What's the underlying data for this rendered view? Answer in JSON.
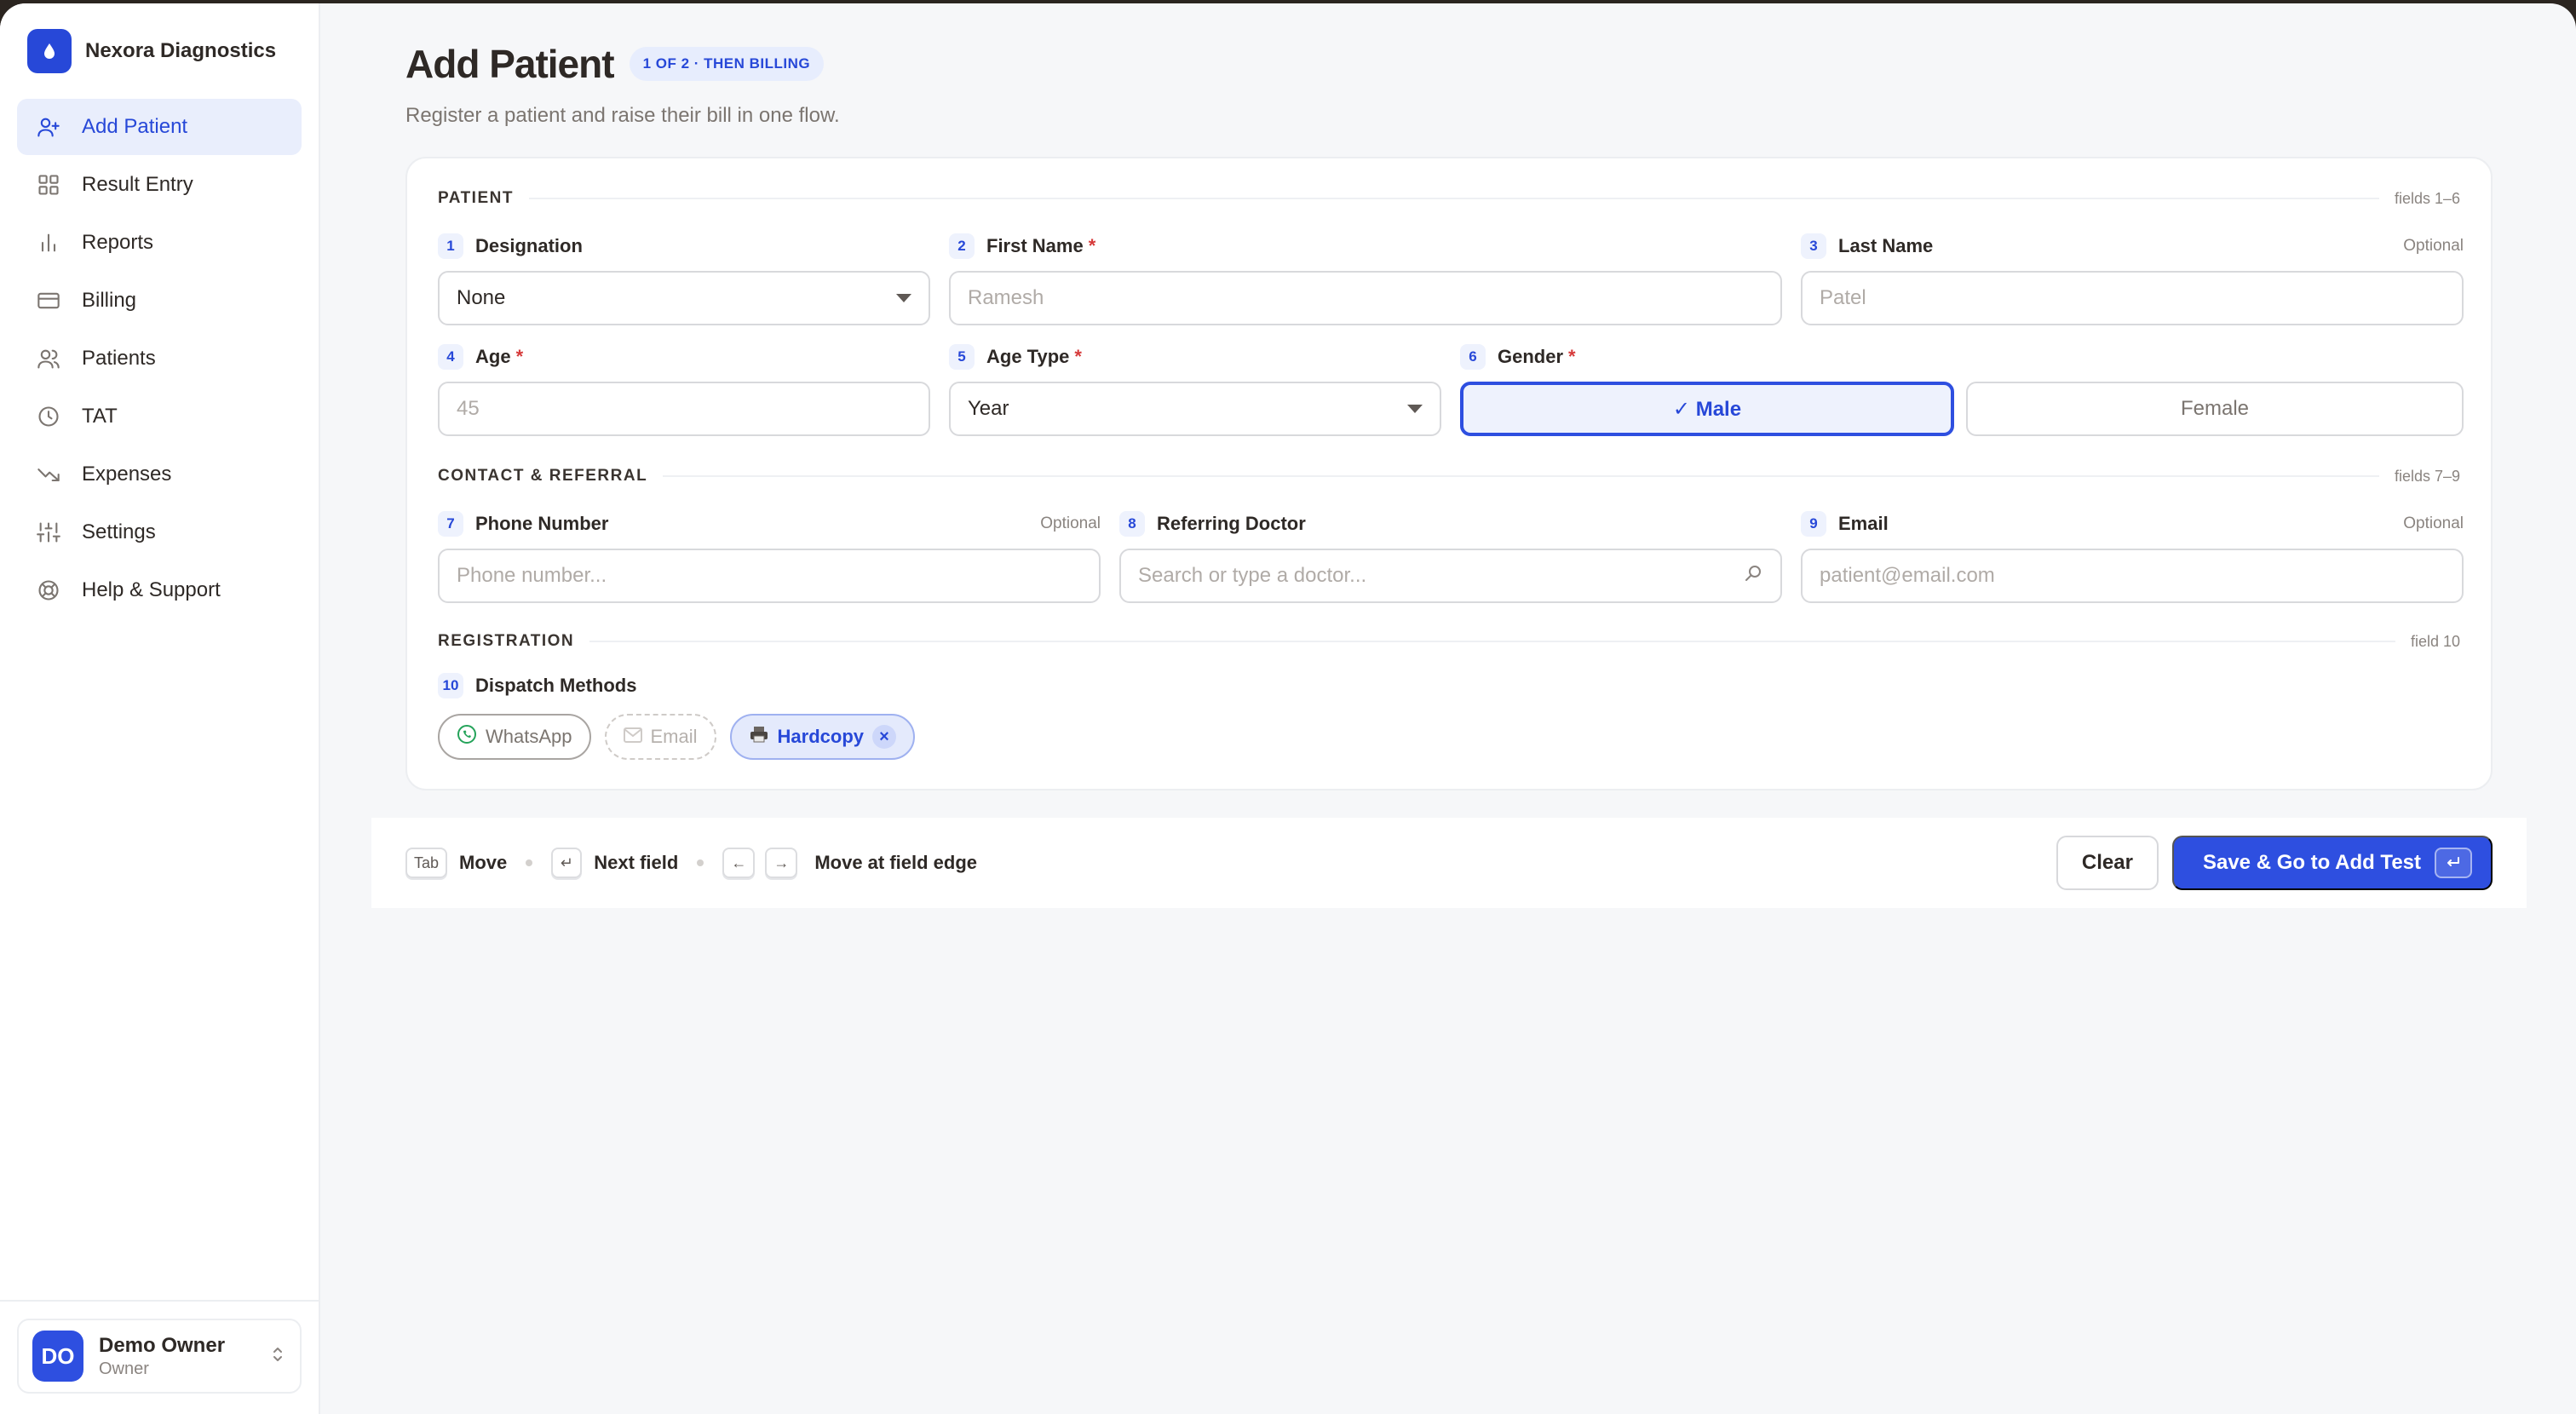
{
  "app": {
    "name": "Nexora Diagnostics"
  },
  "sidebar": {
    "items": [
      {
        "label": "Add Patient",
        "icon": "user-plus-icon",
        "active": true
      },
      {
        "label": "Result Entry",
        "icon": "grid-icon"
      },
      {
        "label": "Reports",
        "icon": "bar-chart-icon"
      },
      {
        "label": "Billing",
        "icon": "card-icon"
      },
      {
        "label": "Patients",
        "icon": "users-icon"
      },
      {
        "label": "TAT",
        "icon": "clock-icon"
      },
      {
        "label": "Expenses",
        "icon": "trend-down-icon"
      },
      {
        "label": "Settings",
        "icon": "sliders-icon"
      },
      {
        "label": "Help & Support",
        "icon": "lifebuoy-icon"
      }
    ],
    "user": {
      "initials": "DO",
      "name": "Demo Owner",
      "role": "Owner"
    }
  },
  "header": {
    "title": "Add Patient",
    "step_badge": "1 OF 2 · THEN BILLING",
    "subtitle": "Register a patient and raise their bill in one flow."
  },
  "sections": {
    "patient": {
      "title": "PATIENT",
      "meta": "fields 1–6"
    },
    "contact": {
      "title": "CONTACT & REFERRAL",
      "meta": "fields 7–9"
    },
    "registration": {
      "title": "REGISTRATION",
      "meta": "field 10"
    }
  },
  "fields": {
    "designation": {
      "num": "1",
      "label": "Designation",
      "value": "None"
    },
    "first_name": {
      "num": "2",
      "label": "First Name",
      "required": "*",
      "placeholder": "Ramesh"
    },
    "last_name": {
      "num": "3",
      "label": "Last Name",
      "optional": "Optional",
      "placeholder": "Patel"
    },
    "age": {
      "num": "4",
      "label": "Age",
      "required": "*",
      "placeholder": "45"
    },
    "age_type": {
      "num": "5",
      "label": "Age Type",
      "required": "*",
      "value": "Year"
    },
    "gender": {
      "num": "6",
      "label": "Gender",
      "required": "*",
      "options": [
        "✓ Male",
        "Female"
      ],
      "selected": "Male"
    },
    "phone": {
      "num": "7",
      "label": "Phone Number",
      "optional": "Optional",
      "placeholder": "Phone number..."
    },
    "doctor": {
      "num": "8",
      "label": "Referring Doctor",
      "placeholder": "Search or type a doctor..."
    },
    "email": {
      "num": "9",
      "label": "Email",
      "optional": "Optional",
      "placeholder": "patient@email.com"
    },
    "dispatch": {
      "num": "10",
      "label": "Dispatch Methods",
      "chips": [
        {
          "label": "WhatsApp",
          "state": "unselected"
        },
        {
          "label": "Email",
          "state": "disabled"
        },
        {
          "label": "Hardcopy",
          "state": "selected"
        }
      ]
    }
  },
  "footer": {
    "hints": [
      {
        "key": "Tab",
        "text": "Move"
      },
      {
        "key": "↵",
        "text": "Next field"
      },
      {
        "keys": [
          "←",
          "→"
        ],
        "text": "Move at field edge"
      }
    ],
    "clear_label": "Clear",
    "primary_label": "Save & Go to Add Test"
  },
  "colors": {
    "accent": "#2E4FE0",
    "required": "#D63A3A",
    "background": "#F6F7F9"
  }
}
